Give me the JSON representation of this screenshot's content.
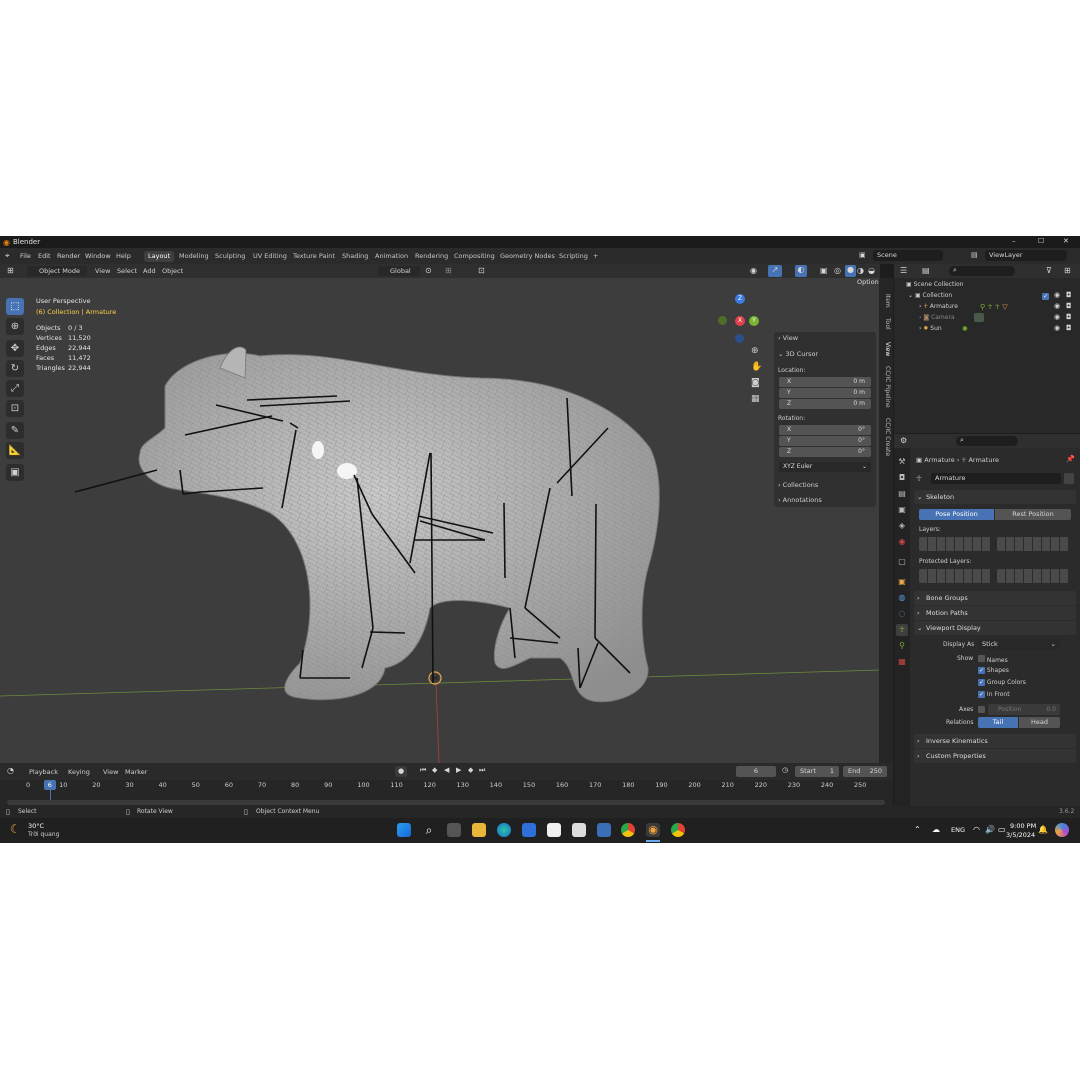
{
  "window": {
    "app_title": "Blender",
    "min": "–",
    "max": "☐",
    "close": "✕"
  },
  "menu": {
    "items": [
      "File",
      "Edit",
      "Render",
      "Window",
      "Help"
    ]
  },
  "workspaces": [
    "Layout",
    "Modeling",
    "Sculpting",
    "UV Editing",
    "Texture Paint",
    "Shading",
    "Animation",
    "Rendering",
    "Compositing",
    "Geometry Nodes",
    "Scripting",
    "+"
  ],
  "scene": {
    "label": "Scene",
    "view_layer": "ViewLayer"
  },
  "viewport_header": {
    "mode": "Object Mode",
    "menus": [
      "View",
      "Select",
      "Add",
      "Object"
    ],
    "transform": "Global",
    "options": "Options"
  },
  "overlay_text": {
    "perspective": "User Perspective",
    "collection": "(6) Collection | Armature",
    "stats": [
      {
        "label": "Objects",
        "value": "0 / 3"
      },
      {
        "label": "Vertices",
        "value": "11,520"
      },
      {
        "label": "Edges",
        "value": "22,944"
      },
      {
        "label": "Faces",
        "value": "11,472"
      },
      {
        "label": "Triangles",
        "value": "22,944"
      }
    ]
  },
  "gizmo": {
    "z": "Z",
    "y": "Y",
    "x": "X"
  },
  "npanel": {
    "view": "View",
    "cursor": "3D Cursor",
    "location": "Location:",
    "loc": [
      {
        "axis": "X",
        "val": "0 m"
      },
      {
        "axis": "Y",
        "val": "0 m"
      },
      {
        "axis": "Z",
        "val": "0 m"
      }
    ],
    "rotation": "Rotation:",
    "rot": [
      {
        "axis": "X",
        "val": "0°"
      },
      {
        "axis": "Y",
        "val": "0°"
      },
      {
        "axis": "Z",
        "val": "0°"
      }
    ],
    "euler": "XYZ Euler",
    "collections": "Collections",
    "annotations": "Annotations"
  },
  "side_tabs": [
    "Item",
    "Tool",
    "View",
    "CC/IC Pipeline",
    "CC/IC Create"
  ],
  "outliner": {
    "root": "Scene Collection",
    "collection": "Collection",
    "items": [
      "Armature",
      "Camera",
      "Sun"
    ]
  },
  "properties": {
    "breadcrumb_a": "Armature",
    "breadcrumb_b": "Armature",
    "name": "Armature",
    "skeleton": "Skeleton",
    "pose_position": "Pose Position",
    "rest_position": "Rest Position",
    "layers": "Layers:",
    "protected_layers": "Protected Layers:",
    "bone_groups": "Bone Groups",
    "motion_paths": "Motion Paths",
    "viewport_display": "Viewport Display",
    "display_as_label": "Display As",
    "display_as_value": "Stick",
    "show_label": "Show",
    "show_names": "Names",
    "show_shapes": "Shapes",
    "show_group_colors": "Group Colors",
    "show_in_front": "In Front",
    "axes_label": "Axes",
    "axes_position": "Position",
    "axes_value": "0.0",
    "relations_label": "Relations",
    "tail": "Tail",
    "head": "Head",
    "inverse_kinematics": "Inverse Kinematics",
    "custom_properties": "Custom Properties"
  },
  "timeline": {
    "menus": [
      "Playback",
      "Keying",
      "View",
      "Marker"
    ],
    "current_frame": "6",
    "start_label": "Start",
    "start": "1",
    "end_label": "End",
    "end": "250",
    "ruler": [
      "0",
      "10",
      "20",
      "30",
      "40",
      "50",
      "60",
      "70",
      "80",
      "90",
      "100",
      "110",
      "120",
      "130",
      "140",
      "150",
      "160",
      "170",
      "180",
      "190",
      "200",
      "210",
      "220",
      "230",
      "240",
      "250"
    ],
    "playhead_frame": "6"
  },
  "status_bar": {
    "select": "Select",
    "rotate": "Rotate View",
    "context": "Object Context Menu",
    "version": "3.6.2"
  },
  "taskbar": {
    "weather_temp": "30°C",
    "weather_desc": "Trời quang",
    "lang": "ENG",
    "time": "9:00 PM",
    "date": "3/5/2024"
  },
  "colors": {
    "accent": "#4772b3",
    "viewport": "#3d3d3d",
    "selected_text": "#ffd24a",
    "panel": "#2b2b2b"
  }
}
